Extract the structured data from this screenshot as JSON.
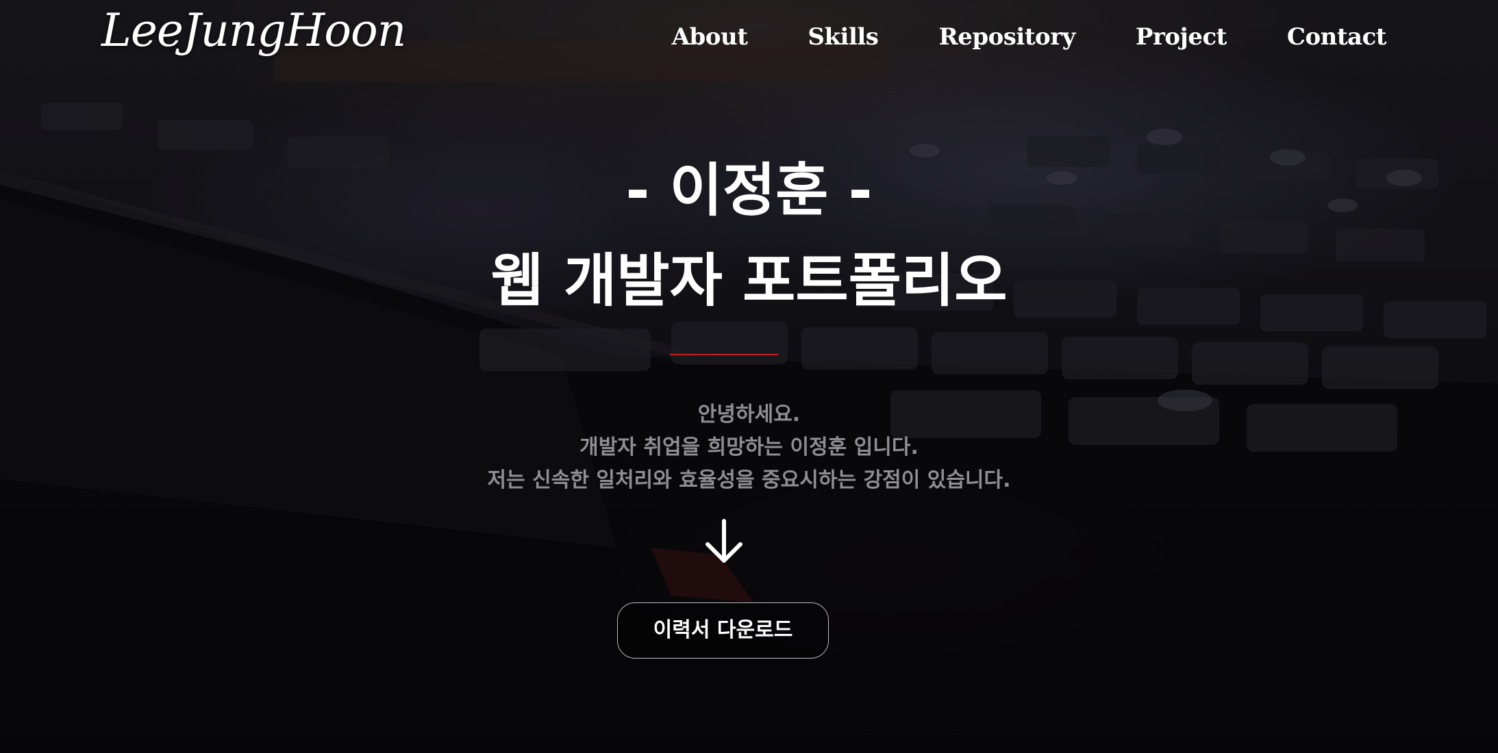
{
  "header": {
    "logo": "LeeJungHoon",
    "nav": [
      "About",
      "Skills",
      "Repository",
      "Project",
      "Contact"
    ]
  },
  "hero": {
    "title_line1": "- 이정훈 -",
    "title_line2": "웹 개발자 포트폴리오",
    "intro_lines": [
      "안녕하세요.",
      "개발자 취업을 희망하는 이정훈 입니다.",
      "저는 신속한 일처리와 효율성을 중요시하는 강점이 있습니다."
    ],
    "scroll_icon": "arrow-down-icon",
    "resume_button": "이력서 다운로드"
  },
  "colors": {
    "accent_divider": "#c4231f",
    "intro_text": "#8f8e93",
    "text": "#ffffff"
  }
}
